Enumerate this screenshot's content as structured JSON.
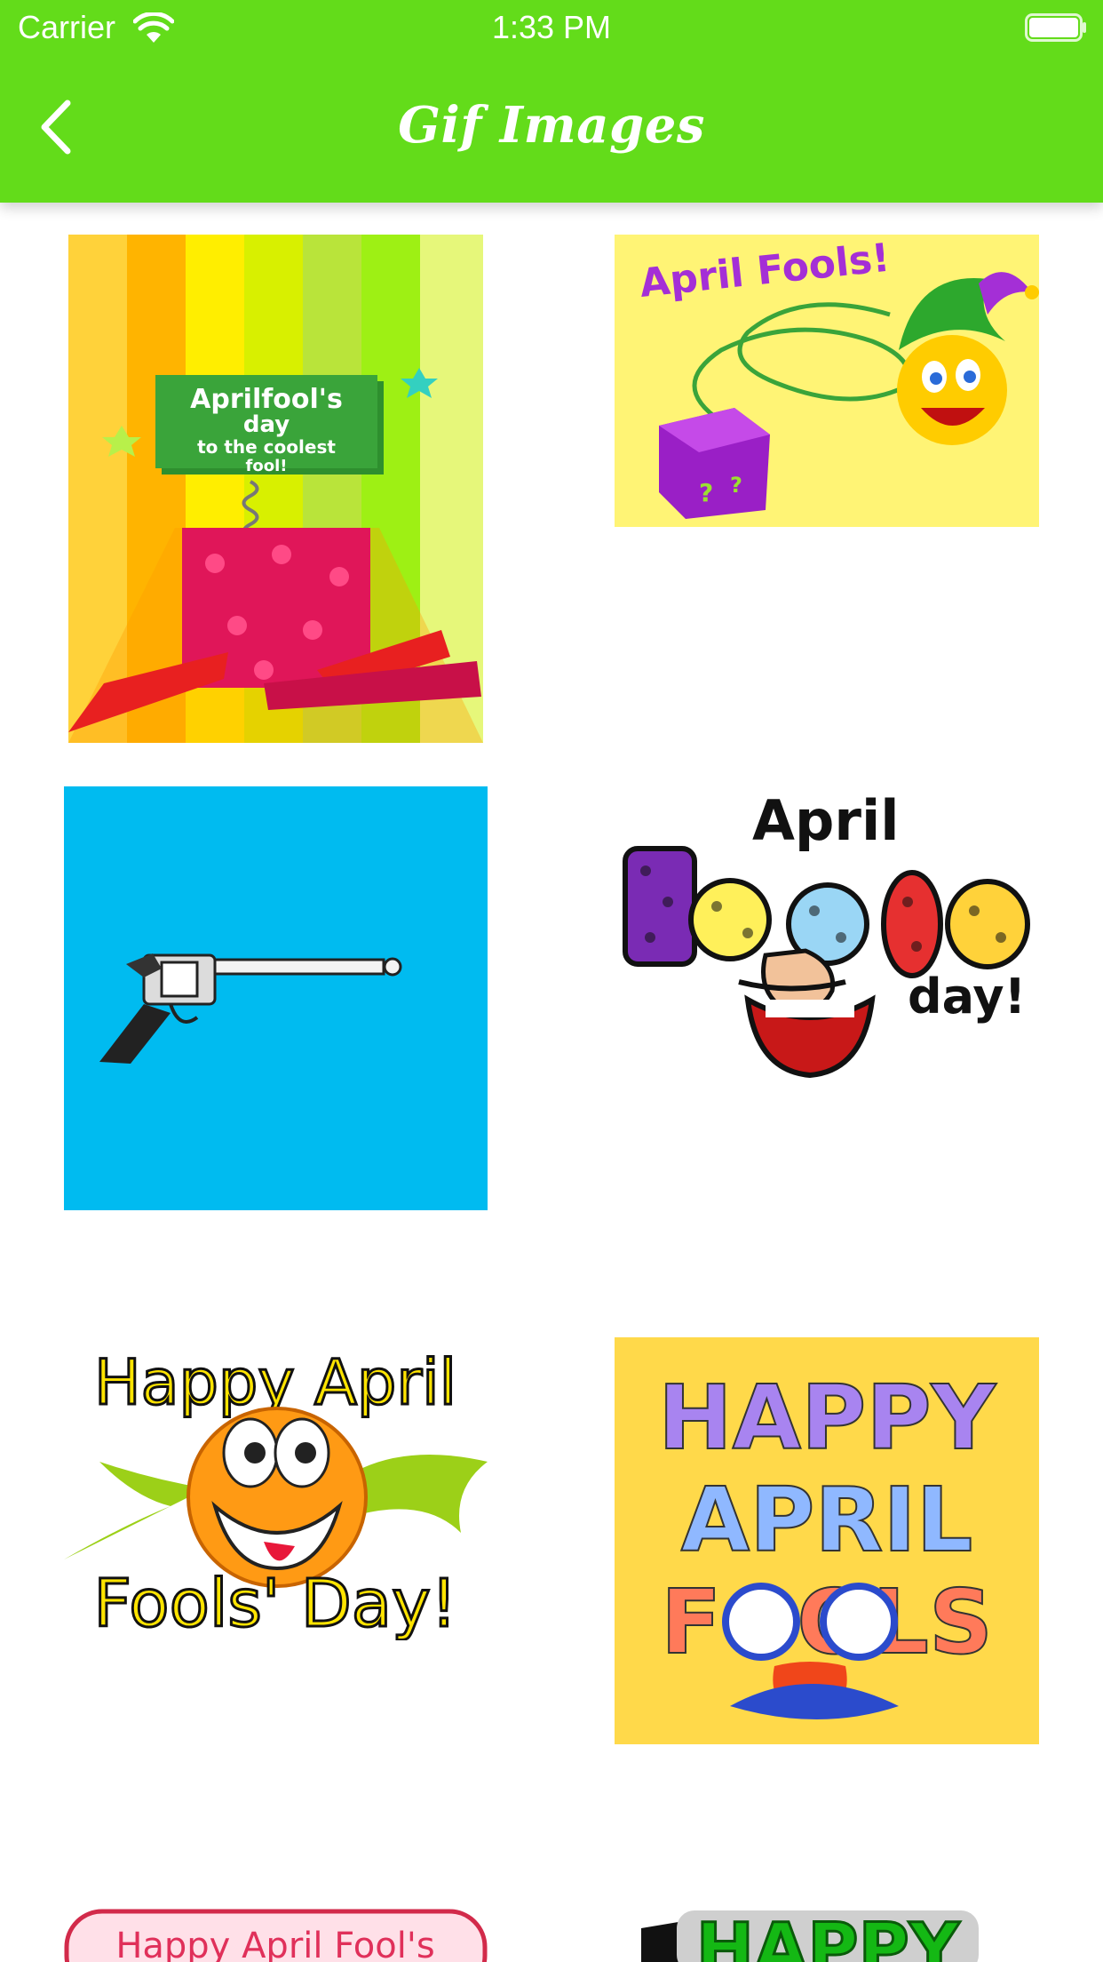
{
  "status_bar": {
    "carrier": "Carrier",
    "time": "1:33 PM"
  },
  "nav": {
    "title": "Gif Images",
    "back_icon": "chevron-left-icon"
  },
  "colors": {
    "nav_green": "#63dc1a",
    "background": "#ffffff"
  },
  "grid": {
    "items": [
      {
        "text": [
          "Aprilfool's",
          "day",
          "to the coolest",
          "fool!"
        ]
      },
      {
        "text": [
          "April Fools!"
        ]
      },
      {
        "text": []
      },
      {
        "text": [
          "April",
          "Fools",
          "day!"
        ]
      },
      {
        "text": [
          "Happy April",
          "Fools' Day!"
        ]
      },
      {
        "text": [
          "HAPPY",
          "APRIL",
          "FOOLS"
        ]
      },
      {
        "text": [
          "Happy April Fool's"
        ]
      },
      {
        "text": [
          "HAPPY"
        ]
      }
    ]
  }
}
